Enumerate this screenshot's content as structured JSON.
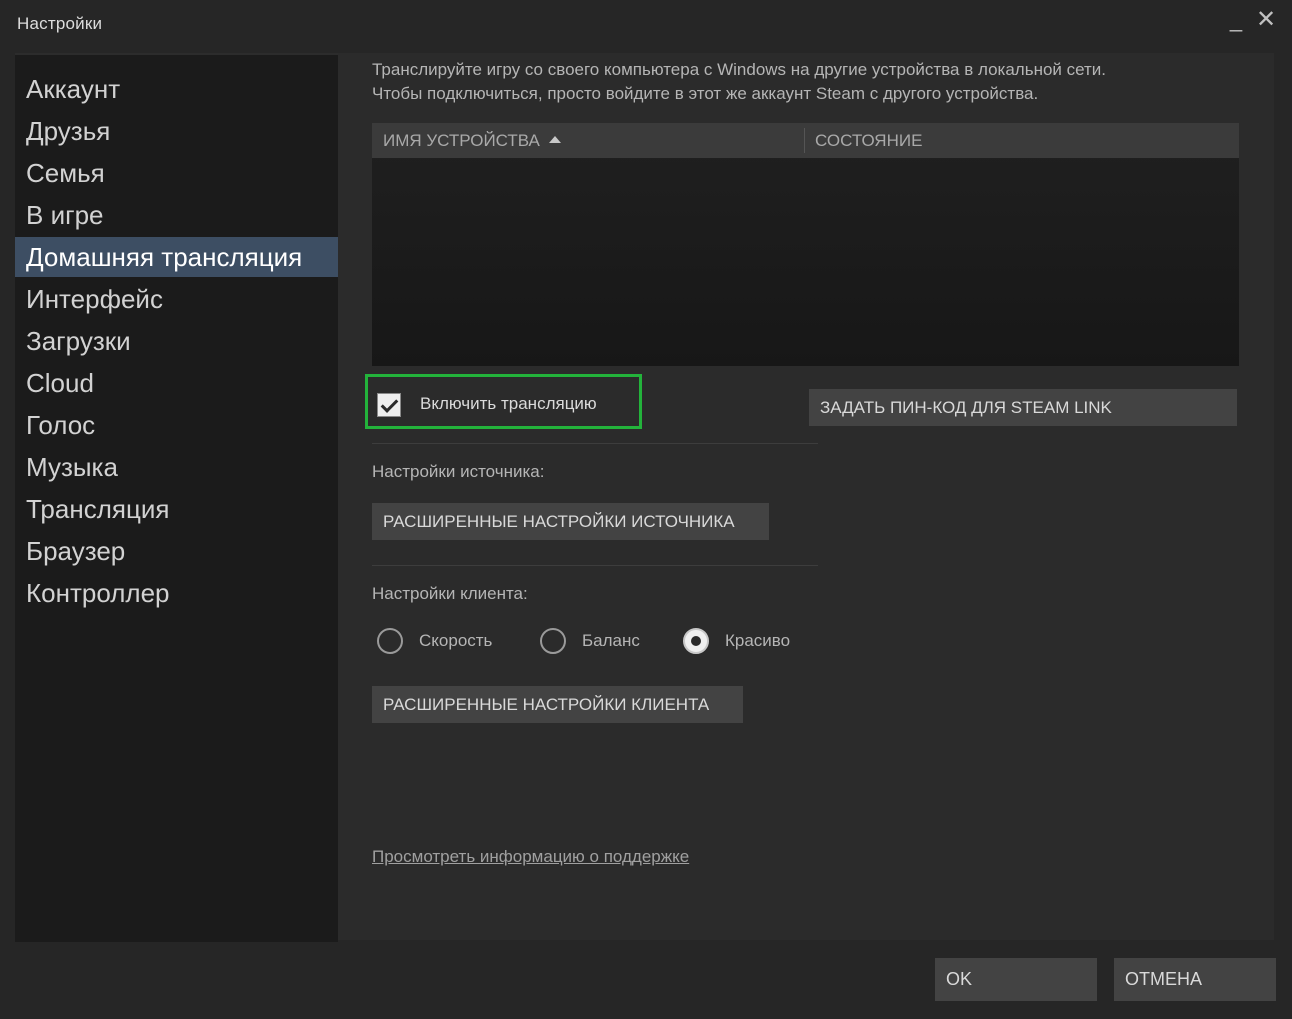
{
  "window": {
    "title": "Настройки",
    "minimize_glyph": "_",
    "close_glyph": "✕"
  },
  "sidebar": {
    "items": [
      {
        "label": "Аккаунт"
      },
      {
        "label": "Друзья"
      },
      {
        "label": "Семья"
      },
      {
        "label": "В игре"
      },
      {
        "label": "Домашняя трансляция",
        "active": true
      },
      {
        "label": "Интерфейс"
      },
      {
        "label": "Загрузки"
      },
      {
        "label": "Cloud"
      },
      {
        "label": "Голос"
      },
      {
        "label": "Музыка"
      },
      {
        "label": "Трансляция"
      },
      {
        "label": "Браузер"
      },
      {
        "label": "Контроллер"
      }
    ]
  },
  "main": {
    "description_line1": "Транслируйте игру со своего компьютера с Windows на другие устройства в локальной сети.",
    "description_line2": "Чтобы подключиться, просто войдите в этот же аккаунт Steam с другого устройства.",
    "table": {
      "columns": [
        "ИМЯ УСТРОЙСТВА",
        "СОСТОЯНИЕ"
      ],
      "sorted_column": "ИМЯ УСТРОЙСТВА",
      "sort_direction": "ascending",
      "rows": []
    },
    "enable_streaming": {
      "label": "Включить трансляцию",
      "checked": true
    },
    "pin_button_label": "ЗАДАТЬ ПИН-КОД ДЛЯ STEAM LINK",
    "source_settings_label": "Настройки источника:",
    "source_advanced_button": "РАСШИРЕННЫЕ НАСТРОЙКИ ИСТОЧНИКА",
    "client_settings_label": "Настройки клиента:",
    "client_quality_options": [
      {
        "label": "Скорость",
        "selected": false
      },
      {
        "label": "Баланс",
        "selected": false
      },
      {
        "label": "Красиво",
        "selected": true
      }
    ],
    "client_advanced_button": "РАСШИРЕННЫЕ НАСТРОЙКИ КЛИЕНТА",
    "support_link": "Просмотреть информацию о поддержке"
  },
  "footer": {
    "ok_label": "OK",
    "cancel_label": "ОТМЕНА"
  },
  "colors": {
    "window_bg": "#262626",
    "sidebar_bg": "#1b1b1b",
    "content_bg": "#2b2b2b",
    "active_item_bg": "#3d4e63",
    "highlight_border": "#23b33b",
    "button_bg": "#434343"
  }
}
